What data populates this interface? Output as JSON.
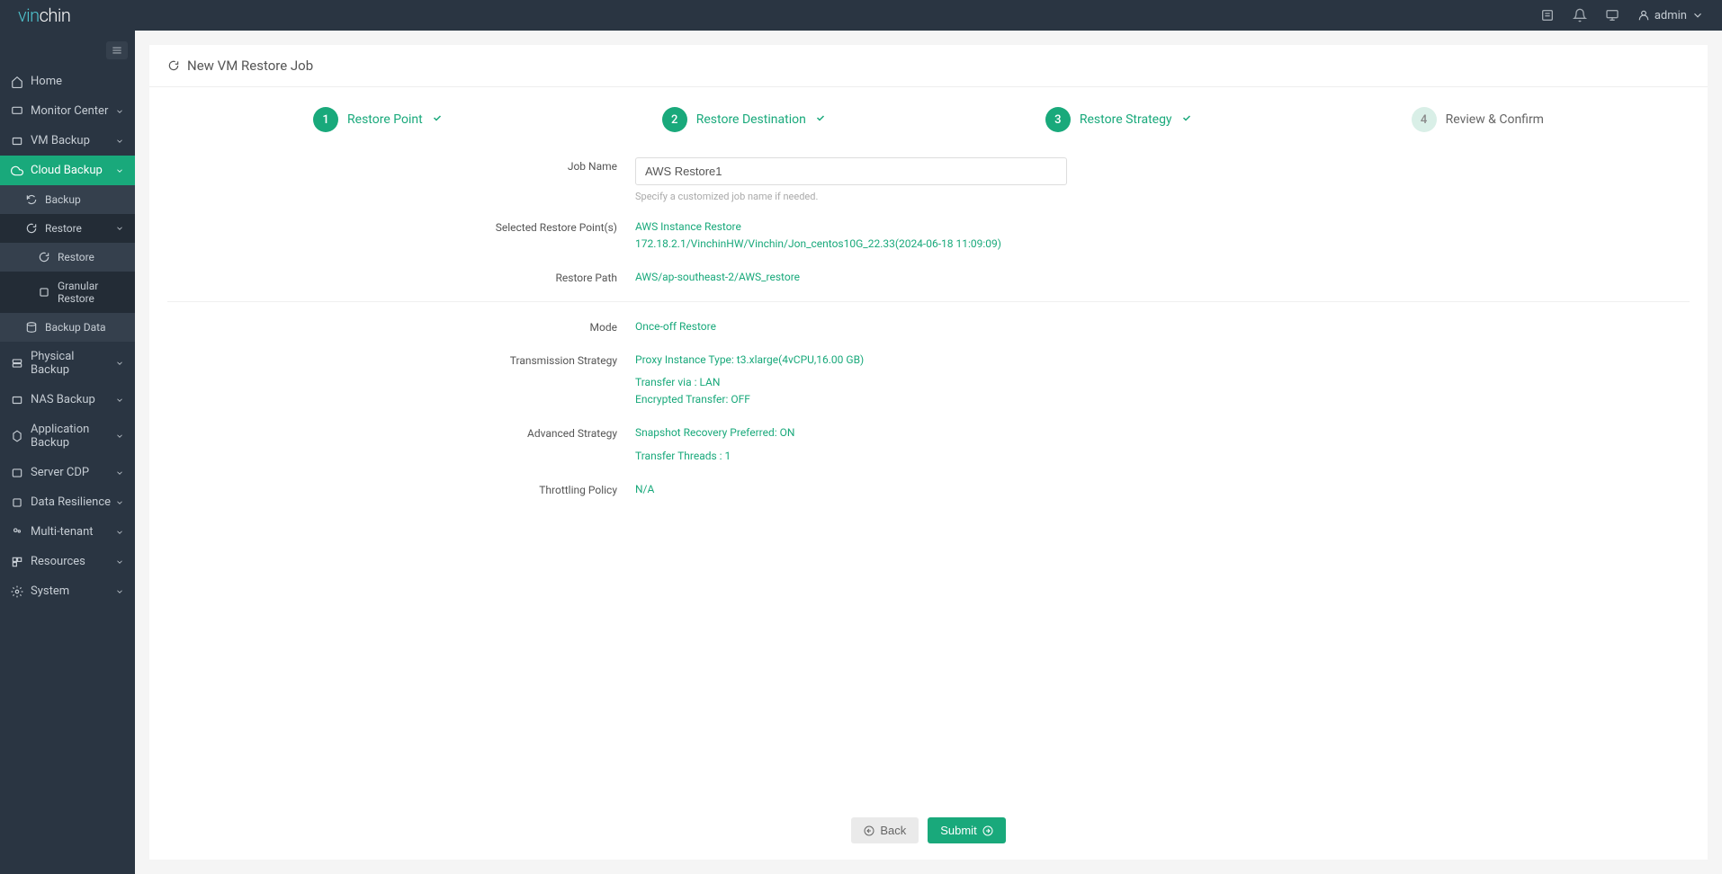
{
  "brand": {
    "part1": "vin",
    "part2": "chin"
  },
  "topbar": {
    "user": "admin"
  },
  "sidebar": {
    "items": [
      {
        "label": "Home"
      },
      {
        "label": "Monitor Center"
      },
      {
        "label": "VM Backup"
      },
      {
        "label": "Cloud Backup"
      },
      {
        "label": "Backup"
      },
      {
        "label": "Restore"
      },
      {
        "label": "Restore"
      },
      {
        "label": "Granular Restore"
      },
      {
        "label": "Backup Data"
      },
      {
        "label": "Physical Backup"
      },
      {
        "label": "NAS Backup"
      },
      {
        "label": "Application Backup"
      },
      {
        "label": "Server CDP"
      },
      {
        "label": "Data Resilience"
      },
      {
        "label": "Multi-tenant"
      },
      {
        "label": "Resources"
      },
      {
        "label": "System"
      }
    ]
  },
  "panel": {
    "title": "New VM Restore Job"
  },
  "wizard": {
    "steps": [
      {
        "num": "1",
        "label": "Restore Point"
      },
      {
        "num": "2",
        "label": "Restore Destination"
      },
      {
        "num": "3",
        "label": "Restore Strategy"
      },
      {
        "num": "4",
        "label": "Review & Confirm"
      }
    ]
  },
  "form": {
    "job_name_label": "Job Name",
    "job_name_value": "AWS Restore1",
    "job_name_hint": "Specify a customized job name if needed.",
    "restore_points_label": "Selected Restore Point(s)",
    "restore_points_line1": "AWS Instance Restore",
    "restore_points_line2": "172.18.2.1/VinchinHW/Vinchin/Jon_centos10G_22.33(2024-06-18 11:09:09)",
    "restore_path_label": "Restore Path",
    "restore_path_value": "AWS/ap-southeast-2/AWS_restore",
    "mode_label": "Mode",
    "mode_value": "Once-off Restore",
    "transmission_label": "Transmission Strategy",
    "transmission_line1": "Proxy Instance Type: t3.xlarge(4vCPU,16.00 GB)",
    "transmission_line2": "Transfer via : LAN",
    "transmission_line3": "Encrypted Transfer: OFF",
    "advanced_label": "Advanced Strategy",
    "advanced_line1": "Snapshot Recovery Preferred: ON",
    "advanced_line2": "Transfer Threads : 1",
    "throttling_label": "Throttling Policy",
    "throttling_value": "N/A"
  },
  "actions": {
    "back": "Back",
    "submit": "Submit"
  }
}
